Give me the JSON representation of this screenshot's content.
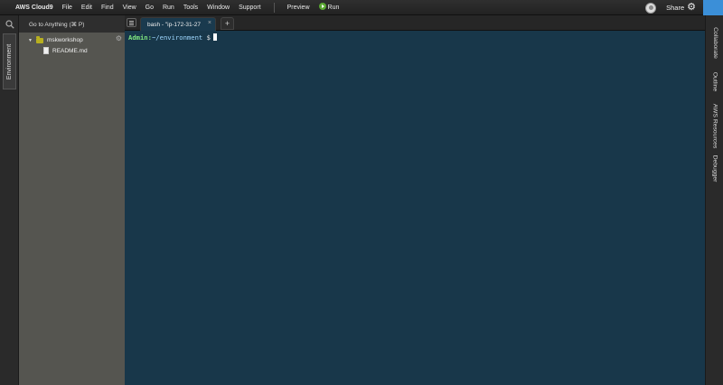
{
  "menubar": {
    "brand": "AWS Cloud9",
    "items": [
      "File",
      "Edit",
      "Find",
      "View",
      "Go",
      "Run",
      "Tools",
      "Window",
      "Support"
    ],
    "preview": "Preview",
    "run": "Run",
    "share": "Share"
  },
  "left_panel": {
    "tab": "Environment",
    "goto_placeholder": "Go to Anything (⌘ P)"
  },
  "tree": [
    {
      "name": "mskworkshop",
      "type": "folder",
      "expanded": true
    },
    {
      "name": "README.md",
      "type": "file"
    }
  ],
  "editor": {
    "tab_label": "bash - \"ip-172-31-27",
    "tab_close": "×",
    "new_tab": "+"
  },
  "terminal": {
    "user": "Admin:",
    "path": "~/environment",
    "symbol": "$"
  },
  "right_panel": {
    "tabs": [
      "Collaborate",
      "Outline",
      "AWS Resources",
      "Debugger"
    ]
  },
  "colors": {
    "terminal_bg": "#18374a",
    "sidebar_bg": "#555550",
    "accent_blue": "#3b8fd8",
    "run_green": "#5aa832"
  }
}
